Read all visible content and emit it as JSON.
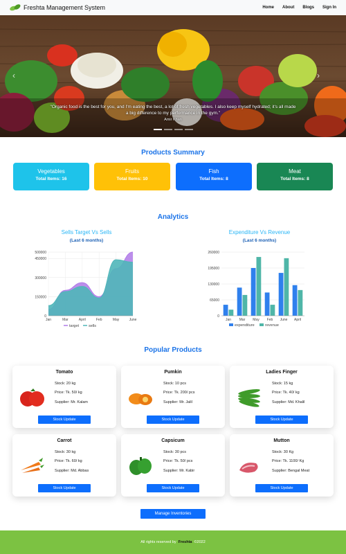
{
  "navbar": {
    "brand": "Freshta Management System",
    "links": [
      "Home",
      "About",
      "Blogs",
      "Sign In"
    ]
  },
  "hero": {
    "quote": "\"Organic food is the best for you, and I'm eating the best, a lot of fresh vegetables. I also keep myself hydrated; it's all made a big difference to my performance in the gym.\"",
    "author": "Amir Khan"
  },
  "summary": {
    "title": "Products Summary",
    "cards": [
      {
        "title": "Vegetables",
        "total": "Total Items: 16",
        "color": "#1ec3ea"
      },
      {
        "title": "Fruits",
        "total": "Total Items: 10",
        "color": "#ffc107"
      },
      {
        "title": "Fish",
        "total": "Total Items: 8",
        "color": "#0d6efd"
      },
      {
        "title": "Meat",
        "total": "Total Items: 8",
        "color": "#198754"
      }
    ]
  },
  "analytics": {
    "title": "Analytics",
    "sells_chart": {
      "title": "Sells Target Vs Sells",
      "subtitle": "(Last 6 months)"
    },
    "expense_chart": {
      "title": "Expenditure Vs Revenue",
      "subtitle": "(Last 6 months)"
    }
  },
  "chart_data": [
    {
      "type": "area",
      "x": [
        "Jan",
        "Mar",
        "April",
        "Feb",
        "May",
        "June"
      ],
      "ylim": [
        0,
        500000
      ],
      "yticks": [
        "0",
        "150000",
        "300000",
        "450000",
        "500000"
      ],
      "series": [
        {
          "name": "target",
          "values": [
            50000,
            200000,
            260000,
            150000,
            370000,
            500000
          ],
          "color": "#b07ae8"
        },
        {
          "name": "sells",
          "values": [
            80000,
            190000,
            230000,
            140000,
            440000,
            420000
          ],
          "color": "#4fb6b9"
        }
      ]
    },
    {
      "type": "bar",
      "categories": [
        "Jan",
        "Mar",
        "May",
        "Feb",
        "June",
        "April"
      ],
      "ylim": [
        0,
        260000
      ],
      "yticks": [
        "0",
        "65000",
        "130000",
        "195000",
        "260000"
      ],
      "series": [
        {
          "name": "expenditure",
          "values": [
            45000,
            115000,
            195000,
            95000,
            175000,
            125000
          ],
          "color": "#2f80ed"
        },
        {
          "name": "revenue",
          "values": [
            25000,
            85000,
            240000,
            45000,
            235000,
            105000
          ],
          "color": "#4fb6a8"
        }
      ]
    }
  ],
  "popular": {
    "title": "Popular Products",
    "products": [
      {
        "name": "Tomato",
        "stock": "Stock: 20 kg",
        "price": "Price: Tk. 50/ kg",
        "supplier": "Supplier: Mr. Kalam",
        "button": "Stock Update",
        "icon": "tomato-icon"
      },
      {
        "name": "Pumkin",
        "stock": "Stock: 10 pcs",
        "price": "Price: Tk. 200/ pcs",
        "supplier": "Supplier: Mr. Jalil",
        "button": "Stock Update",
        "icon": "pumpkin-icon"
      },
      {
        "name": "Ladies Finger",
        "stock": "Stock: 15 kg",
        "price": "Price: Tk. 40/ kg",
        "supplier": "Supplier: Md. Khalil",
        "button": "Stock Update",
        "icon": "okra-icon"
      },
      {
        "name": "Carrot",
        "stock": "Stock: 30 kg",
        "price": "Price: Tk. 60/ kg",
        "supplier": "Supplier: Md. Abbas",
        "button": "Stock Update",
        "icon": "carrot-icon"
      },
      {
        "name": "Capsicum",
        "stock": "Stock: 30 pcs",
        "price": "Price: Tk. 50/ pcs",
        "supplier": "Supplier: Mr. Kabir",
        "button": "Stock Update",
        "icon": "capsicum-icon"
      },
      {
        "name": "Mutton",
        "stock": "Stock: 30 Kg",
        "price": "Price: Tk. 1100/ Kg",
        "supplier": "Supplier: Bengal Meat",
        "button": "Stock Update",
        "icon": "meat-icon"
      }
    ],
    "manage_button": "Manage Inventories"
  },
  "footer": {
    "prefix": "All rights reserved by",
    "brand": "Freshta",
    "suffix": "©2022"
  }
}
